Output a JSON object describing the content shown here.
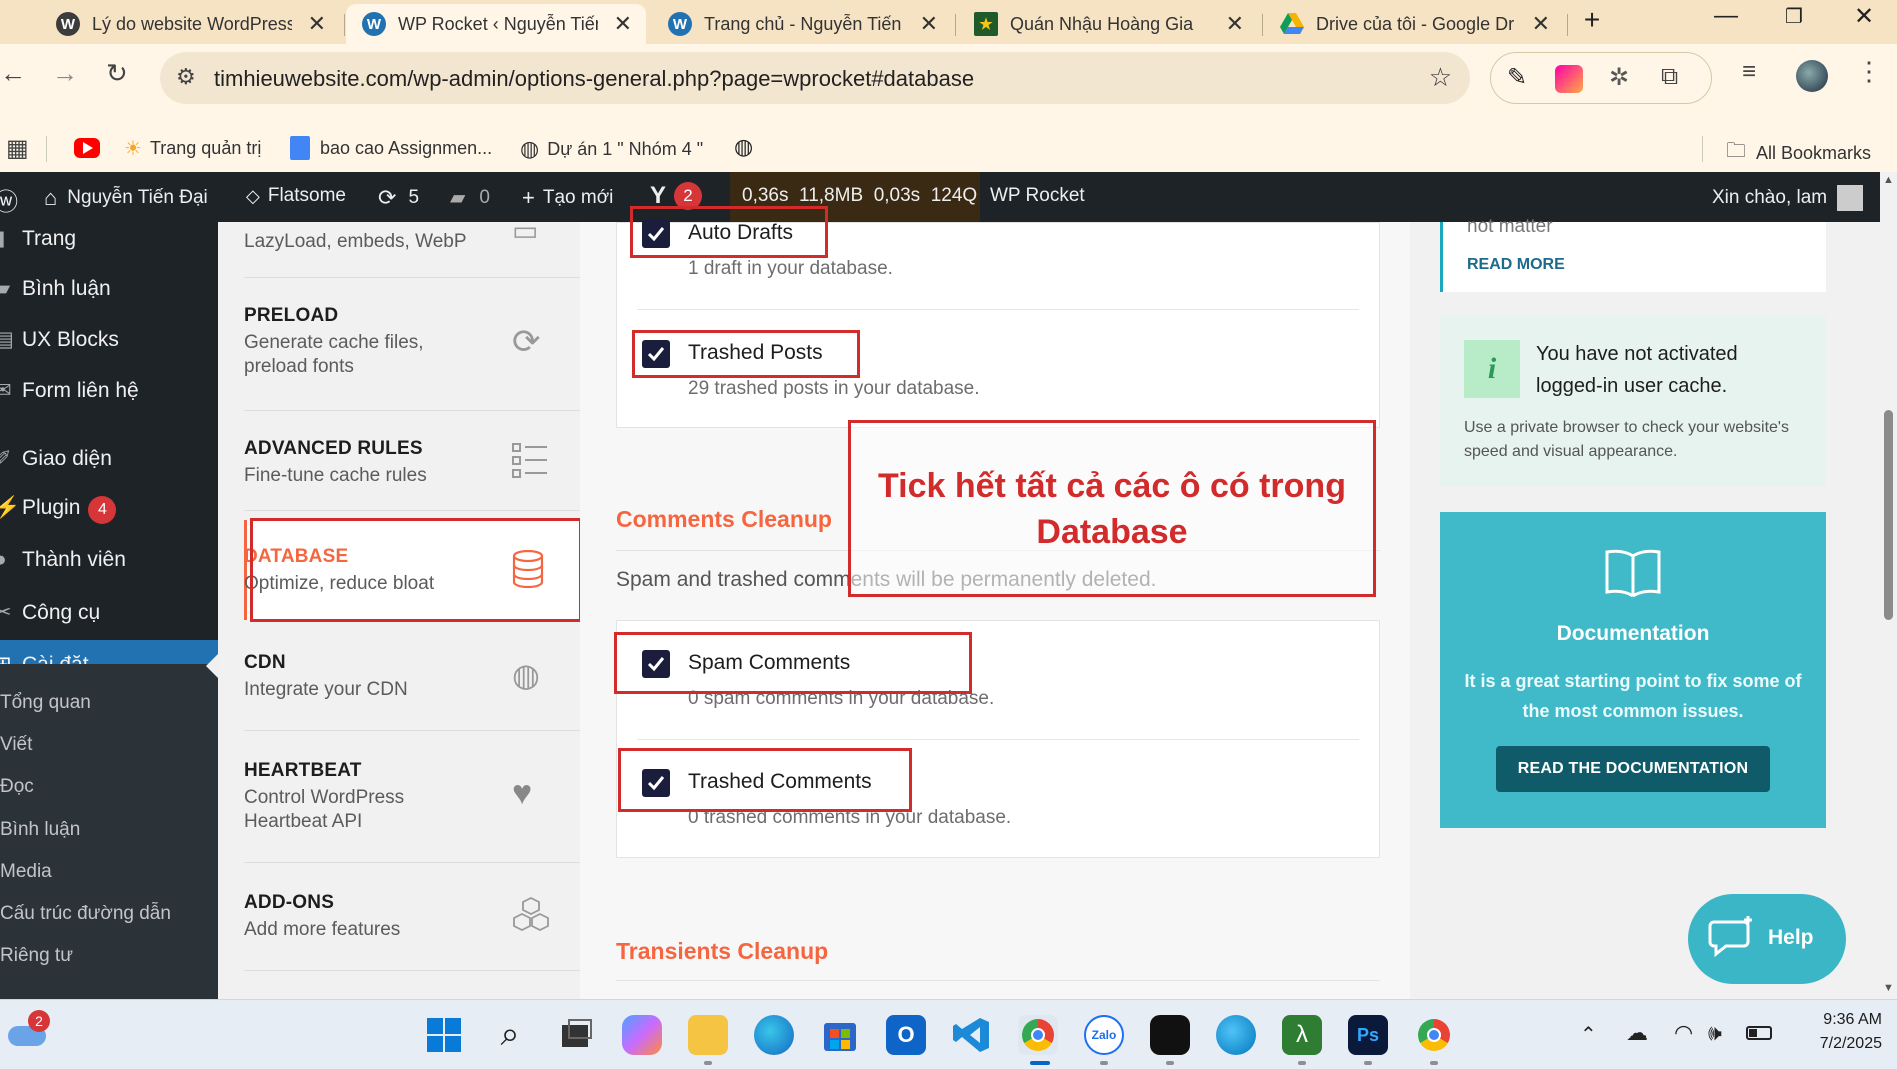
{
  "browser": {
    "tabs": [
      {
        "title": "Lý do website WordPress",
        "favicon": "wordpress-icon",
        "active": false
      },
      {
        "title": "WP Rocket ‹ Nguyễn Tiến",
        "favicon": "wordpress-icon",
        "active": true
      },
      {
        "title": "Trang chủ - Nguyễn Tiến",
        "favicon": "wordpress-icon",
        "active": false
      },
      {
        "title": "Quán Nhậu Hoàng Gia",
        "favicon": "star-icon",
        "active": false
      },
      {
        "title": "Drive của tôi - Google Dr",
        "favicon": "google-drive-icon",
        "active": false
      }
    ],
    "new_tab": "+",
    "url": "timhieuwebsite.com/wp-admin/options-general.php?page=wprocket#database",
    "bookmarks": [
      {
        "label": "",
        "icon": "youtube-icon"
      },
      {
        "label": "Trang quản trị",
        "icon": "sun-icon"
      },
      {
        "label": "bao cao Assignmen...",
        "icon": "docs-icon"
      },
      {
        "label": "Dự án 1 \" Nhóm 4 \"",
        "icon": "globe-icon"
      },
      {
        "label": "",
        "icon": "globe-icon"
      }
    ],
    "all_bookmarks": "All Bookmarks"
  },
  "adminbar": {
    "site_name": "Nguyễn Tiến Đại",
    "theme": "Flatsome",
    "updates": "5",
    "comments": "0",
    "new": "Tạo mới",
    "yoast_count": "2",
    "perf": "0,36s  11,8MB  0,03s  124Q",
    "perf_time": "0,36s",
    "perf_mem": "11,8MB",
    "perf_db": "0,03s",
    "perf_queries": "124Q",
    "plugin": "WP Rocket",
    "greeting": "Xin chào, lam"
  },
  "wpmenu": {
    "items": [
      {
        "label": "Trang",
        "icon": "page-icon"
      },
      {
        "label": "Bình luận",
        "icon": "comment-icon"
      },
      {
        "label": "UX Blocks",
        "icon": "blocks-icon"
      },
      {
        "label": "Form liên hệ",
        "icon": "mail-icon"
      },
      {
        "label": "Giao diện",
        "icon": "brush-icon"
      },
      {
        "label": "Plugin",
        "icon": "plugin-icon",
        "badge": "4"
      },
      {
        "label": "Thành viên",
        "icon": "user-icon"
      },
      {
        "label": "Công cụ",
        "icon": "wrench-icon"
      },
      {
        "label": "Cài đặt",
        "icon": "settings-icon",
        "active": true
      }
    ],
    "submenu": [
      "Tổng quan",
      "Viết",
      "Đọc",
      "Bình luận",
      "Media",
      "Cấu trúc đường dẫn",
      "Riêng tư"
    ]
  },
  "rocketnav": {
    "items": [
      {
        "title": "",
        "desc": "LazyLoad, embeds, WebP",
        "icon": "image-icon"
      },
      {
        "title": "PRELOAD",
        "desc": "Generate cache files, preload fonts",
        "icon": "refresh-icon"
      },
      {
        "title": "ADVANCED RULES",
        "desc": "Fine-tune cache rules",
        "icon": "list-icon"
      },
      {
        "title": "DATABASE",
        "desc": "Optimize, reduce bloat",
        "icon": "database-icon",
        "active": true
      },
      {
        "title": "CDN",
        "desc": "Integrate your CDN",
        "icon": "cdn-icon"
      },
      {
        "title": "HEARTBEAT",
        "desc": "Control WordPress Heartbeat API",
        "icon": "heart-icon"
      },
      {
        "title": "ADD-ONS",
        "desc": "Add more features",
        "icon": "cubes-icon"
      }
    ]
  },
  "main": {
    "posts": [
      {
        "label": "Auto Drafts",
        "desc": "1 draft in your database.",
        "checked": true
      },
      {
        "label": "Trashed Posts",
        "desc": "29 trashed posts in your database.",
        "checked": true
      }
    ],
    "comments_title": "Comments Cleanup",
    "comments_desc": "Spam and trashed comments will be permanently deleted.",
    "comments": [
      {
        "label": "Spam Comments",
        "desc": "0 spam comments in your database.",
        "checked": true
      },
      {
        "label": "Trashed Comments",
        "desc": "0 trashed comments in your database.",
        "checked": true
      }
    ],
    "transients_title": "Transients Cleanup",
    "annotation": "Tick hết tất cả các ô có trong Database"
  },
  "sidebar": {
    "partial_text": "not matter",
    "read_more": "READ MORE",
    "notice_title": "You have not activated logged-in user cache.",
    "notice_desc": "Use a private browser to check your website's speed and visual appearance.",
    "doc_title": "Documentation",
    "doc_desc": "It is a great starting point to fix some of the most common issues.",
    "doc_button": "READ THE DOCUMENTATION",
    "help": "Help"
  },
  "taskbar": {
    "weather_badge": "2",
    "time": "9:36 AM",
    "date": "7/2/2025",
    "apps": [
      "windows-start-icon",
      "search-icon",
      "task-view-icon",
      "copilot-icon",
      "file-explorer-icon",
      "edge-icon",
      "store-icon",
      "outlook-icon",
      "vscode-icon",
      "chrome-icon",
      "zalo-icon",
      "capcut-icon",
      "app-blue-icon",
      "app-green-icon",
      "photoshop-icon",
      "chrome-profile-icon"
    ]
  },
  "colors": {
    "accent_orange": "#f56640",
    "annotation_red": "#d12b2b",
    "wp_dark": "#1d2327",
    "wp_blue": "#2271b1",
    "doc_teal": "#40b9c8"
  }
}
